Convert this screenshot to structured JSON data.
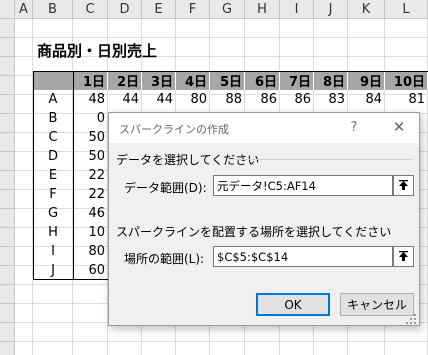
{
  "columns": [
    "A",
    "B",
    "C",
    "D",
    "E",
    "F",
    "G",
    "H",
    "I",
    "J",
    "K",
    "L"
  ],
  "sheet_title": "商品別・日別売上",
  "day_headers": [
    "1日",
    "2日",
    "3日",
    "4日",
    "5日",
    "6日",
    "7日",
    "8日",
    "9日",
    "10日"
  ],
  "rows": [
    {
      "label": "A",
      "values": [
        "48",
        "44",
        "44",
        "80",
        "88",
        "86",
        "86",
        "83",
        "84",
        "81"
      ]
    },
    {
      "label": "B",
      "values": [
        "0"
      ]
    },
    {
      "label": "C",
      "values": [
        "50"
      ]
    },
    {
      "label": "D",
      "values": [
        "50"
      ]
    },
    {
      "label": "E",
      "values": [
        "22"
      ]
    },
    {
      "label": "F",
      "values": [
        "22"
      ]
    },
    {
      "label": "G",
      "values": [
        "46"
      ]
    },
    {
      "label": "H",
      "values": [
        "10"
      ]
    },
    {
      "label": "I",
      "values": [
        "80"
      ]
    },
    {
      "label": "J",
      "values": [
        "60"
      ]
    }
  ],
  "dialog": {
    "title": "スパークラインの作成",
    "help": "?",
    "close": "✕",
    "data_section": "データを選択してください",
    "data_range_label": "データ範囲(D):",
    "data_range_value": "元データ!C5:AF14",
    "location_section": "スパークラインを配置する場所を選択してください",
    "location_label": "場所の範囲(L):",
    "location_value": "$C$5:$C$14",
    "ok": "OK",
    "cancel": "キャンセル"
  },
  "icons": {
    "picker": "range-select-icon",
    "grip": "resize-grip-icon"
  }
}
